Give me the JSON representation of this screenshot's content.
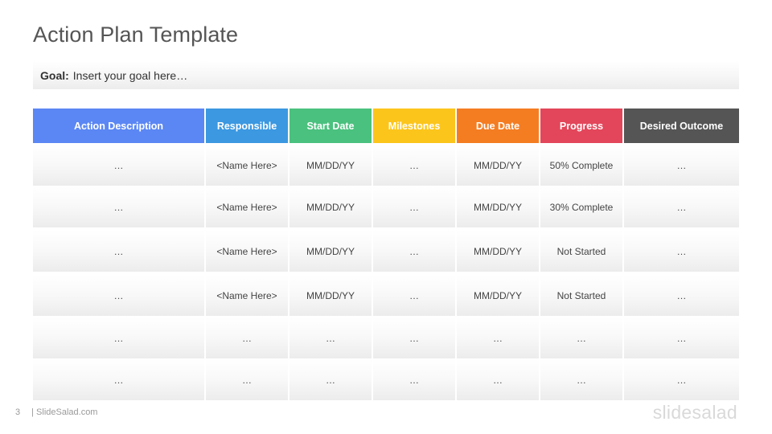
{
  "slide": {
    "title": "Action Plan Template",
    "goal": {
      "label": "Goal:",
      "text": "Insert your goal here…"
    },
    "table": {
      "headers": [
        {
          "label": "Action Description",
          "color": "#5b87f4"
        },
        {
          "label": "Responsible",
          "color": "#3b98e1"
        },
        {
          "label": "Start Date",
          "color": "#4ac17e"
        },
        {
          "label": "Milestones",
          "color": "#fcc51c"
        },
        {
          "label": "Due Date",
          "color": "#f47d22"
        },
        {
          "label": "Progress",
          "color": "#e3465a"
        },
        {
          "label": "Desired Outcome",
          "color": "#555555"
        }
      ],
      "rows": [
        [
          "…",
          "<Name Here>",
          "MM/DD/YY",
          "…",
          "MM/DD/YY",
          "50% Complete",
          "…"
        ],
        [
          "…",
          "<Name Here>",
          "MM/DD/YY",
          "…",
          "MM/DD/YY",
          "30% Complete",
          "…"
        ],
        [
          "…",
          "<Name Here>",
          "MM/DD/YY",
          "…",
          "MM/DD/YY",
          "Not Started",
          "…"
        ],
        [
          "…",
          "<Name Here>",
          "MM/DD/YY",
          "…",
          "MM/DD/YY",
          "Not Started",
          "…"
        ],
        [
          "…",
          "…",
          "…",
          "…",
          "…",
          "…",
          "…"
        ],
        [
          "…",
          "…",
          "…",
          "…",
          "…",
          "…",
          "…"
        ]
      ]
    },
    "footer": {
      "page_number": "3",
      "brand": "| SlideSalad.com"
    },
    "logo_text": "slidesalad"
  }
}
